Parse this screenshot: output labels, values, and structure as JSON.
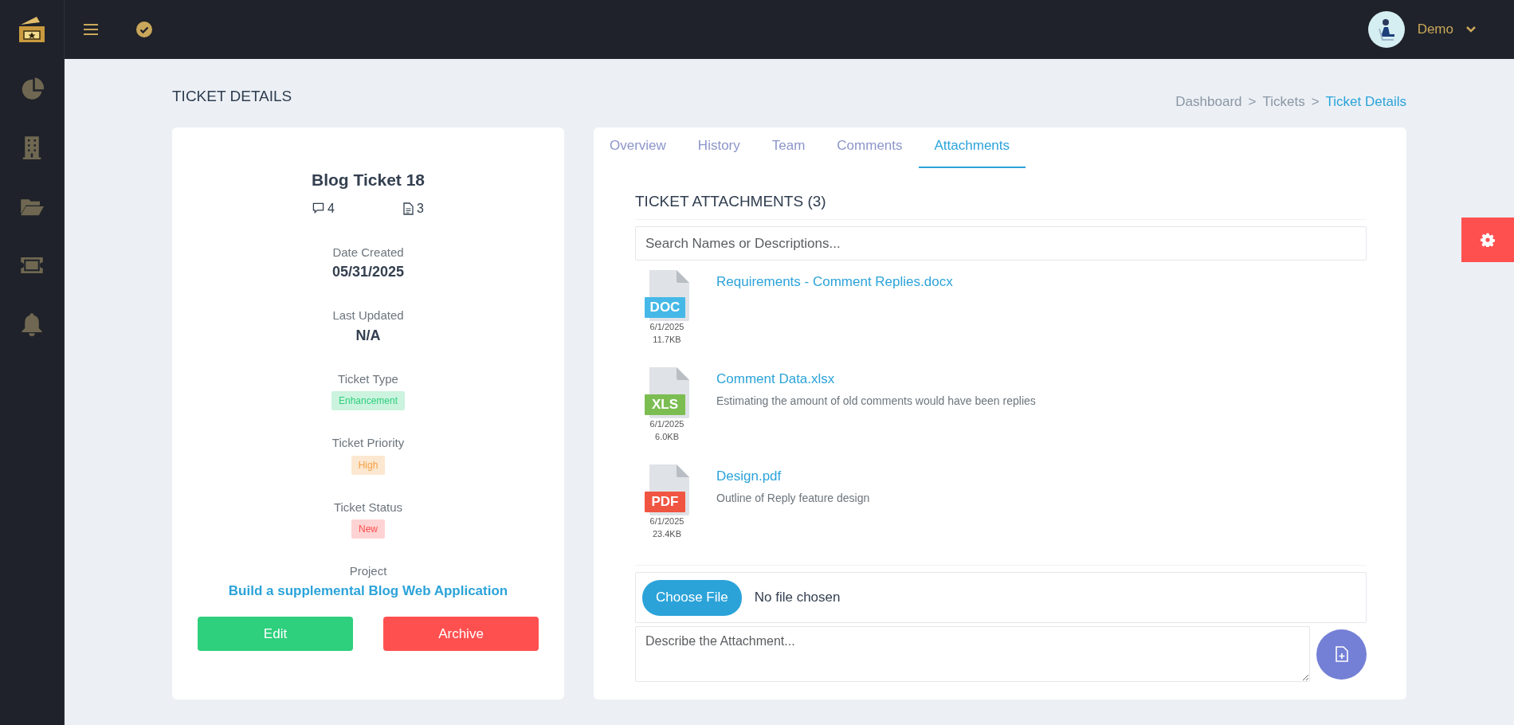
{
  "topbar": {
    "user": {
      "name": "Demo"
    }
  },
  "sidebar": {
    "items": [
      {
        "kind": "chart"
      },
      {
        "kind": "building"
      },
      {
        "kind": "folder"
      },
      {
        "kind": "ticket"
      },
      {
        "kind": "bell"
      }
    ]
  },
  "page_title": "TICKET DETAILS",
  "breadcrumb": {
    "separator": ">",
    "items": [
      {
        "label": "Dashboard",
        "selected": false
      },
      {
        "label": "Tickets",
        "selected": false
      },
      {
        "label": "Ticket Details",
        "selected": true
      }
    ]
  },
  "ticket": {
    "title": "Blog Ticket 18",
    "comment_count": "4",
    "attachment_count": "3",
    "details": [
      {
        "kind": "value",
        "label": "Date Created",
        "value": "05/31/2025"
      },
      {
        "kind": "value",
        "label": "Last Updated",
        "value": "N/A"
      },
      {
        "kind": "badge",
        "label": "Ticket Type",
        "value": "Enhancement",
        "color": "#2ecf7d"
      },
      {
        "kind": "badge",
        "label": "Ticket Priority",
        "value": "High",
        "color": "#f5a142"
      },
      {
        "kind": "badge",
        "label": "Ticket Status",
        "value": "New",
        "color": "#ff4f4f"
      },
      {
        "kind": "link",
        "label": "Project",
        "value": "Build a supplemental Blog Web Application"
      }
    ],
    "buttons": [
      {
        "label": "Edit",
        "kind": "success"
      },
      {
        "label": "Archive",
        "kind": "danger"
      }
    ]
  },
  "tabs": [
    {
      "label": "Overview",
      "selected": false
    },
    {
      "label": "History",
      "selected": false
    },
    {
      "label": "Team",
      "selected": false
    },
    {
      "label": "Comments",
      "selected": false
    },
    {
      "label": "Attachments",
      "selected": true
    }
  ],
  "attachments": {
    "heading": "TICKET ATTACHMENTS (3)",
    "search": {
      "placeholder": "Search Names or Descriptions..."
    },
    "items": [
      {
        "type": "DOC",
        "color": "#45b8e8",
        "name": "Requirements - Comment Replies.docx",
        "date": "6/1/2025",
        "size": "11.7KB"
      },
      {
        "type": "XLS",
        "color": "#7cbd52",
        "name": "Comment Data.xlsx",
        "description": "Estimating the amount of old comments would have been replies",
        "date": "6/1/2025",
        "size": "6.0KB"
      },
      {
        "type": "PDF",
        "color": "#f05542",
        "name": "Design.pdf",
        "description": "Outline of Reply feature design",
        "date": "6/1/2025",
        "size": "23.4KB"
      }
    ],
    "upload": {
      "button": "Choose File",
      "status": "No file chosen",
      "description_placeholder": "Describe the Attachment..."
    }
  }
}
